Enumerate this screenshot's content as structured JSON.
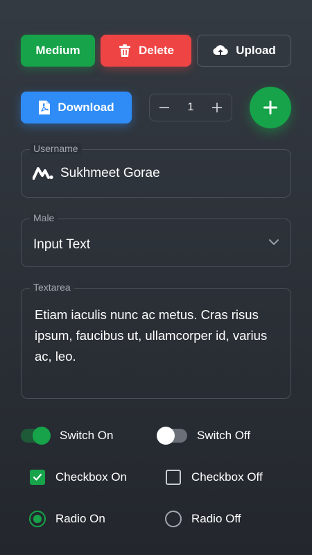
{
  "buttons": {
    "medium_label": "Medium",
    "delete_label": "Delete",
    "upload_label": "Upload",
    "download_label": "Download"
  },
  "stepper": {
    "value": "1"
  },
  "username_field": {
    "legend": "Username",
    "value": "Sukhmeet Gorae"
  },
  "select_field": {
    "legend": "Male",
    "value": "Input Text"
  },
  "textarea_field": {
    "legend": "Textarea",
    "value": "Etiam iaculis nunc ac metus. Cras risus ipsum, faucibus ut, ullamcorper id, varius ac, leo."
  },
  "toggles": {
    "switch_on_label": "Switch On",
    "switch_off_label": "Switch Off",
    "checkbox_on_label": "Checkbox On",
    "checkbox_off_label": "Checkbox Off",
    "radio_on_label": "Radio On",
    "radio_off_label": "Radio Off"
  },
  "icons": {
    "delete": "trash-icon",
    "upload": "cloud-upload-icon",
    "download": "pdf-file-icon",
    "stepper_minus": "minus-icon",
    "stepper_plus": "plus-icon",
    "fab": "plus-icon",
    "username_prefix": "brand-logo-icon",
    "select": "chevron-down-icon",
    "checkbox": "checkmark-icon"
  },
  "colors": {
    "success": "#16a34a",
    "danger": "#ef4444",
    "primary": "#2f8cf6",
    "background": "#2c3138"
  }
}
